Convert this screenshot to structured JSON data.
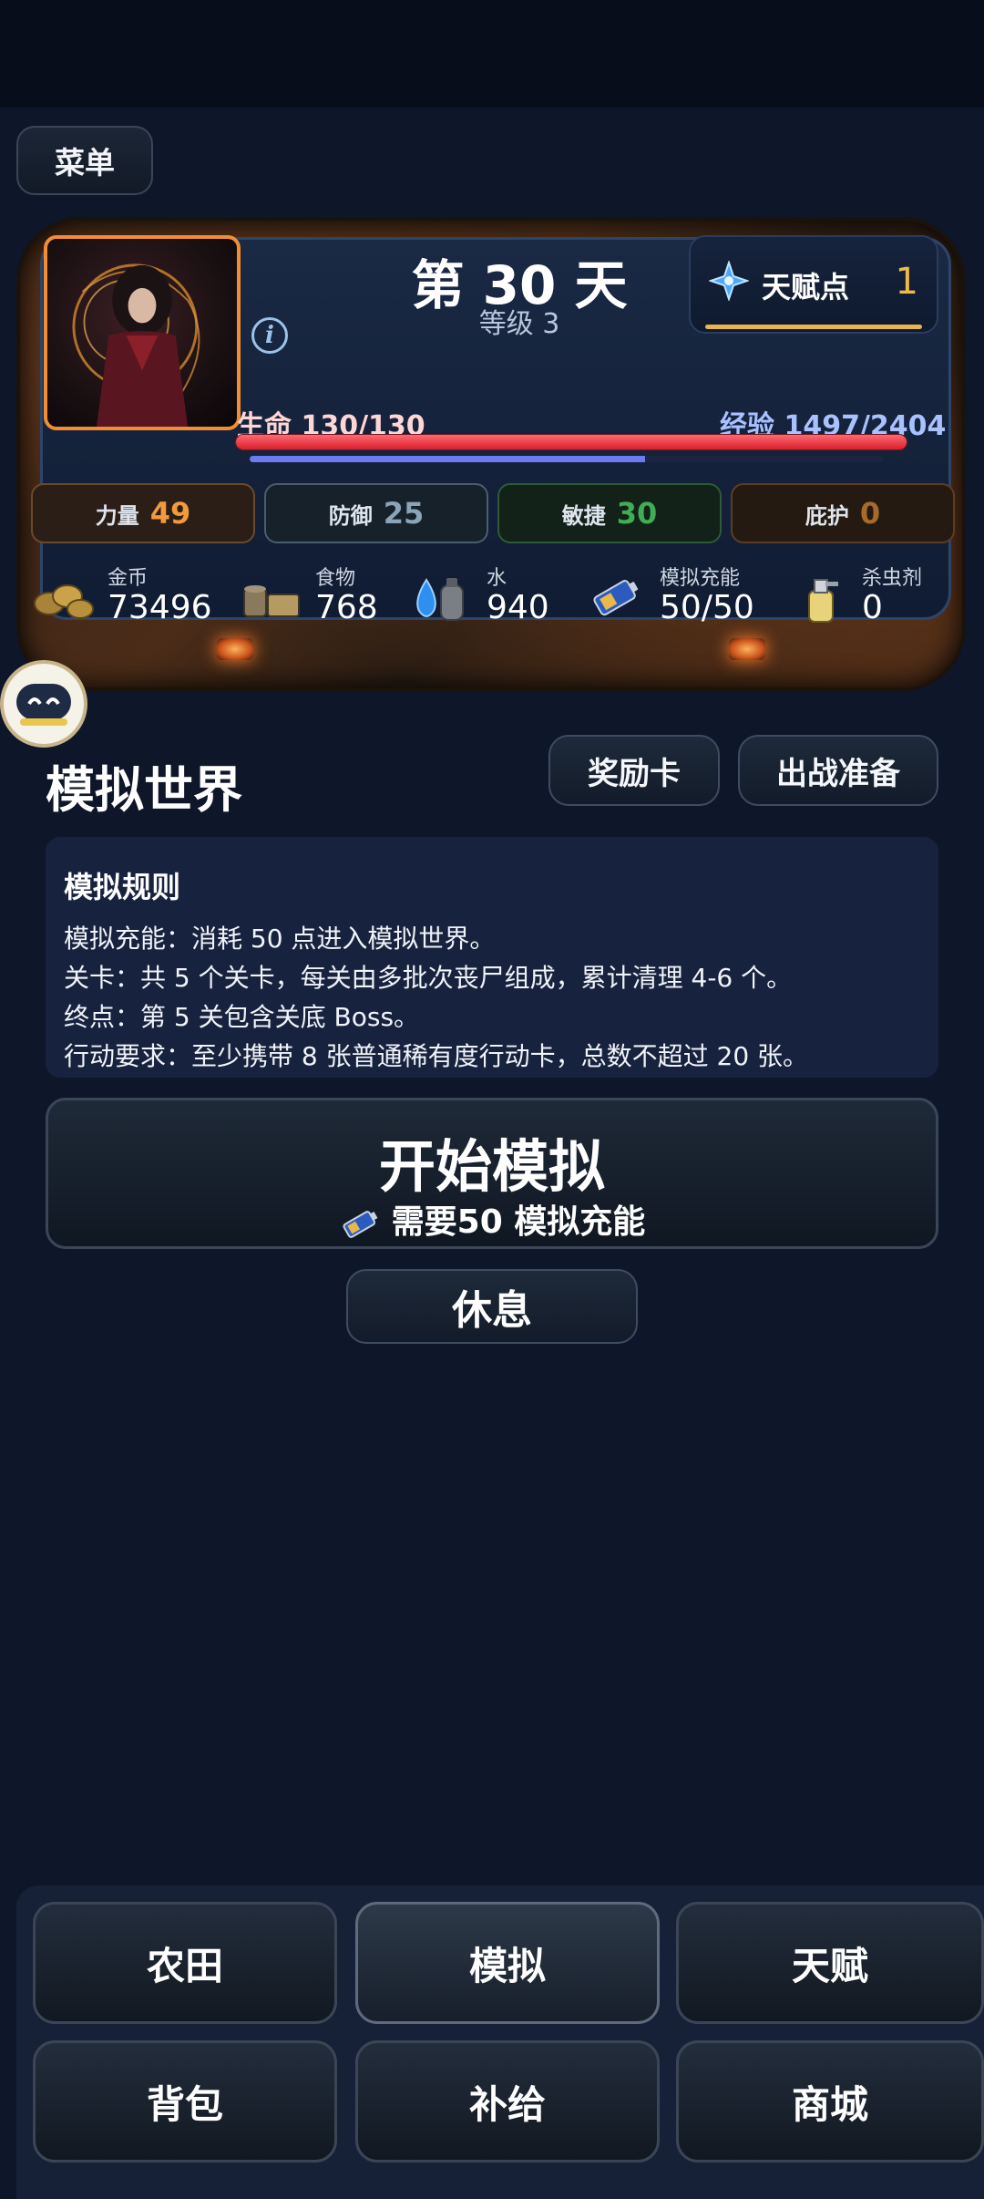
{
  "header": {
    "menu_label": "菜单"
  },
  "character": {
    "day_title": "第 30 天",
    "level": "等级 3",
    "talent_label": "天赋点",
    "talent_value": "1",
    "hp_label": "生命 130/130",
    "hp_fraction": 1.0,
    "exp_label": "经验 1497/2404",
    "exp_fraction": 0.623
  },
  "stats": [
    {
      "name": "力量",
      "value": "49",
      "color": "#f39a3c"
    },
    {
      "name": "防御",
      "value": "25",
      "color": "#8aa4b8"
    },
    {
      "name": "敏捷",
      "value": "30",
      "color": "#3fae55"
    },
    {
      "name": "庇护",
      "value": "0",
      "color": "#a86a2a"
    }
  ],
  "resources": [
    {
      "label": "金币",
      "value": "73496",
      "icon": "coins-icon"
    },
    {
      "label": "食物",
      "value": "768",
      "icon": "food-icon"
    },
    {
      "label": "水",
      "value": "940",
      "icon": "water-icon"
    },
    {
      "label": "模拟充能",
      "value": "50/50",
      "icon": "battery-icon"
    },
    {
      "label": "杀虫剂",
      "value": "0",
      "icon": "spray-icon"
    }
  ],
  "simulation": {
    "title": "模拟世界",
    "reward_card_label": "奖励卡",
    "battle_prep_label": "出战准备",
    "rules_title": "模拟规则",
    "rules": [
      "模拟充能：消耗 50 点进入模拟世界。",
      "关卡：共 5 个关卡，每关由多批次丧尸组成，累计清理 4-6 个。",
      "终点：第 5 关包含关底 Boss。",
      "行动要求：至少携带 8 张普通稀有度行动卡，总数不超过 20 张。"
    ],
    "start_label": "开始模拟",
    "start_cost_label": "需要50 模拟充能",
    "rest_label": "休息"
  },
  "nav": {
    "items": [
      {
        "label": "农田",
        "active": false
      },
      {
        "label": "模拟",
        "active": true
      },
      {
        "label": "天赋",
        "active": false
      },
      {
        "label": "背包",
        "active": false
      },
      {
        "label": "补给",
        "active": false
      },
      {
        "label": "商城",
        "active": false
      }
    ]
  }
}
